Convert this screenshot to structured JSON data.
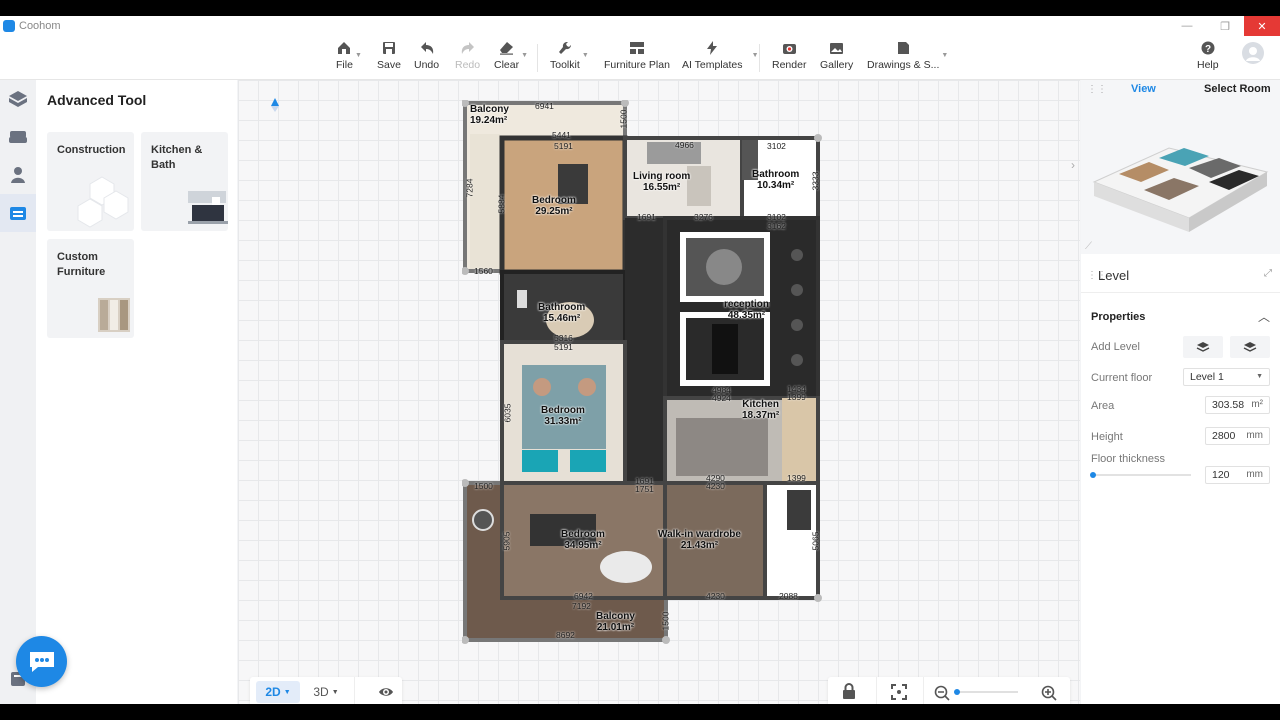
{
  "window": {
    "app_title": "Coohom",
    "minimize": "—",
    "maximize": "❐",
    "close": "✕"
  },
  "toolbar": {
    "file": "File",
    "save": "Save",
    "undo": "Undo",
    "redo": "Redo",
    "clear": "Clear",
    "toolkit": "Toolkit",
    "furniture_plan": "Furniture Plan",
    "ai_templates": "AI Templates",
    "render": "Render",
    "gallery": "Gallery",
    "drawings": "Drawings & S...",
    "help": "Help"
  },
  "left_panel": {
    "title": "Advanced Tool",
    "cards": [
      {
        "label": "Construction"
      },
      {
        "label": "Kitchen & Bath"
      },
      {
        "label": "Custom Furniture"
      }
    ]
  },
  "floorplan": {
    "rooms": [
      {
        "name": "Balcony",
        "area": "19.24m²"
      },
      {
        "name": "Bedroom",
        "area": "29.25m²"
      },
      {
        "name": "Living room",
        "area": "16.55m²"
      },
      {
        "name": "Bathroom",
        "area": "10.34m²"
      },
      {
        "name": "Bathroom",
        "area": "15.46m²"
      },
      {
        "name": "reception",
        "area": "48.35m²"
      },
      {
        "name": "Bedroom",
        "area": "31.33m²"
      },
      {
        "name": "Kitchen",
        "area": "18.37m²"
      },
      {
        "name": "Bedroom",
        "area": "34.95m²"
      },
      {
        "name": "Walk-in wardrobe",
        "area": "21.43m²"
      },
      {
        "name": "Balcony",
        "area": "21.01m²"
      }
    ],
    "dims": {
      "d6941": "6941",
      "d1500a": "1500",
      "d5441": "5441",
      "d5191a": "5191",
      "d4966": "4966",
      "d3102a": "3102",
      "d3102b": "3102",
      "d3162": "3162",
      "d7284": "7284",
      "d5884": "5884",
      "d3333": "3333",
      "d1691a": "1691",
      "d3276": "3276",
      "d1560": "1560",
      "d5316": "5316",
      "d5191b": "5191",
      "d4984": "4984",
      "d4924": "4924",
      "d1434": "1434",
      "d1399a": "1399",
      "d1500b": "1500",
      "d1691b": "1691",
      "d1751": "1751",
      "d4290": "4290",
      "d4230a": "4230",
      "d1399b": "1399",
      "d6942": "6942",
      "d7192": "7192",
      "d4230b": "4230",
      "d2088": "2088",
      "d8692": "8692",
      "d1500c": "1500",
      "d5065": "5065",
      "d5905": "5905",
      "d6035": "6035"
    }
  },
  "bottom": {
    "view2d": "2D",
    "view3d": "3D"
  },
  "right_panel": {
    "tab_view": "View",
    "tab_select_room": "Select Room",
    "level_title": "Level",
    "properties": "Properties",
    "add_level": "Add Level",
    "current_floor_label": "Current floor",
    "current_floor_value": "Level 1",
    "area_label": "Area",
    "area_value": "303.58",
    "area_unit": "m²",
    "height_label": "Height",
    "height_value": "2800",
    "height_unit": "mm",
    "floor_thickness_label": "Floor thickness",
    "floor_thickness_value": "120",
    "floor_thickness_unit": "mm"
  },
  "colors": {
    "accent": "#1e88e5",
    "close_red": "#e53935"
  }
}
